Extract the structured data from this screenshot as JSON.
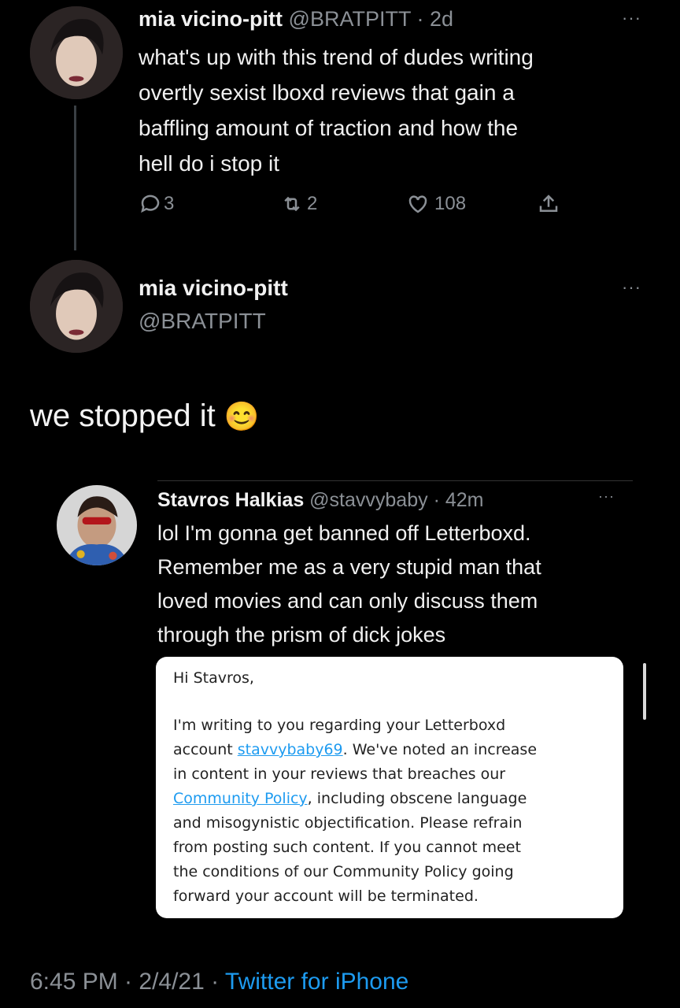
{
  "tweet1": {
    "name": "mia vicino-pitt",
    "handle": "@BRATPITT",
    "time": "· 2d",
    "text_lines": [
      "what's up with this trend of dudes writing",
      "overtly sexist lboxd reviews that gain a",
      "baffling amount of traction and how the",
      "hell do i stop it"
    ],
    "replies": "3",
    "retweets": "2",
    "likes": "108",
    "more": "···"
  },
  "tweet2": {
    "name": "mia vicino-pitt",
    "handle": "@BRATPITT",
    "text": "we stopped it",
    "emoji": "😊",
    "more": "···",
    "timestamp": "6:45 PM · 2/4/21 · ",
    "client": "Twitter for iPhone"
  },
  "quoted": {
    "name": "Stavros Halkias",
    "handle": "@stavvybaby",
    "time": "· 42m",
    "more": "···",
    "text_lines": [
      "lol I'm gonna get banned off Letterboxd.",
      "Remember me as a very stupid man that",
      "loved movies and can only discuss them",
      "through the prism of dick jokes"
    ]
  },
  "email": {
    "greeting": "Hi Stavros,",
    "l1": "I'm writing to you regarding your Letterboxd",
    "l2a": "account ",
    "l2link": "stavvybaby69",
    "l2b": ". We've noted an increase",
    "l3": "in content in your reviews that breaches our",
    "l4link": "Community Policy",
    "l4b": ", including obscene language",
    "l5": "and misogynistic objectification. Please refrain",
    "l6": "from posting such content. If you cannot meet",
    "l7": "the conditions of our Community Policy going",
    "l8": "forward your account will be terminated."
  },
  "colors": {
    "background": "#000000",
    "link": "#1d9bf0",
    "muted": "#8b9096"
  }
}
